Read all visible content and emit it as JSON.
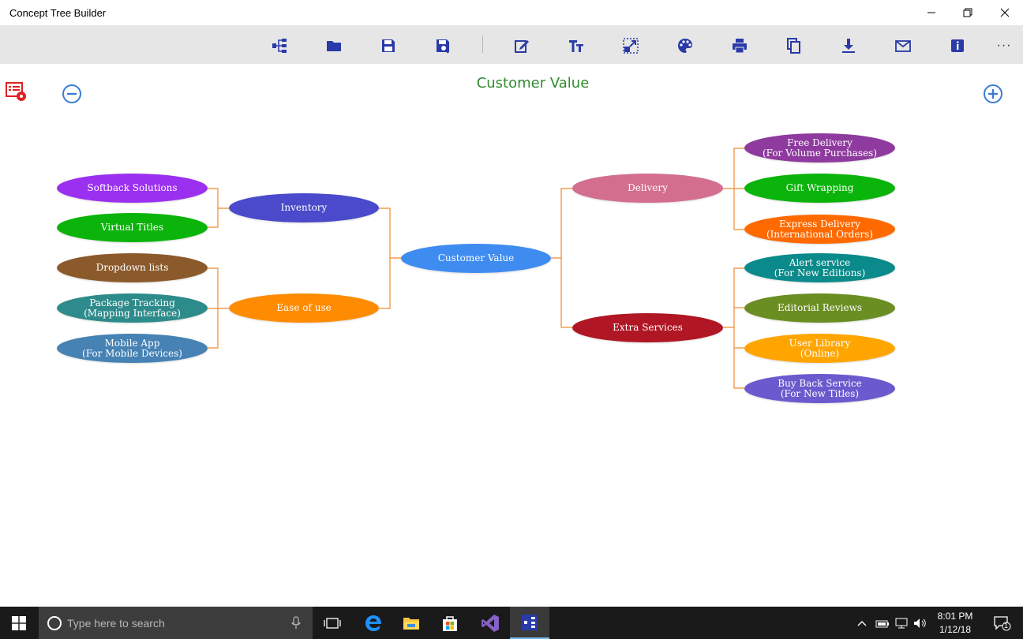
{
  "window": {
    "title": "Concept Tree Builder",
    "controls": [
      "minimize-icon",
      "restore-icon",
      "close-icon"
    ]
  },
  "toolbar": {
    "icons": [
      "tree-structure-icon",
      "open-folder-icon",
      "save-icon",
      "save-as-icon",
      "edit-icon",
      "text-format-icon",
      "resize-icon",
      "palette-icon",
      "print-icon",
      "copy-icon",
      "download-icon",
      "mail-icon",
      "info-icon"
    ],
    "more": "···"
  },
  "canvas": {
    "title": "Customer Value",
    "zoom_out_icon": "zoom-out-icon",
    "zoom_in_icon": "zoom-in-icon",
    "side_icon": "list-settings-icon"
  },
  "tree": {
    "root": {
      "label": "Customer Value",
      "color": "#3f8cf0"
    },
    "inventory": {
      "label": "Inventory",
      "color": "#4a4acb"
    },
    "ease_of_use": {
      "label": "Ease of  use",
      "color": "#ff8c00"
    },
    "delivery": {
      "label": "Delivery",
      "color": "#d36e8e"
    },
    "extra_services": {
      "label": "Extra Services",
      "color": "#b01623"
    },
    "softback": {
      "label": "Softback Solutions",
      "color": "#9b30f0"
    },
    "virtual_titles": {
      "label": "Virtual Titles",
      "color": "#0ab40a"
    },
    "dropdown": {
      "label": "Dropdown lists",
      "color": "#8b5a2b"
    },
    "package_tracking": {
      "label": "Package Tracking\n(Mapping Interface)",
      "color": "#2e8b8b"
    },
    "mobile_app": {
      "label": "Mobile App\n(For Mobile Devices)",
      "color": "#4682b4"
    },
    "free_delivery": {
      "label": "Free Delivery\n(For Volume Purchases)",
      "color": "#8e3a9e"
    },
    "gift_wrapping": {
      "label": "Gift Wrapping",
      "color": "#0ab40a"
    },
    "express_delivery": {
      "label": "Express Delivery\n(International Orders)",
      "color": "#ff6a00"
    },
    "alert_service": {
      "label": "Alert service\n(For New Editions)",
      "color": "#0a8a8a"
    },
    "editorial_reviews": {
      "label": "Editorial Reviews",
      "color": "#6b8e23"
    },
    "user_library": {
      "label": "User Library\n(Online)",
      "color": "#ffa500"
    },
    "buy_back": {
      "label": "Buy Back Service\n(For New Titles)",
      "color": "#6a5acd"
    },
    "connector_color": "#ef8a2e"
  },
  "taskbar": {
    "search_placeholder": "Type here to search",
    "time": "8:01 PM",
    "date": "1/12/18",
    "notification_count": "1"
  }
}
